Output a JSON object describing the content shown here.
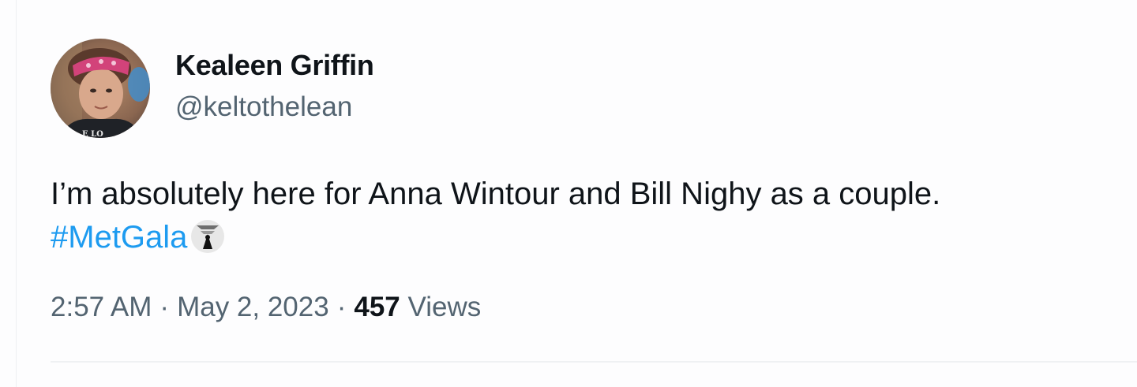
{
  "author": {
    "display_name": "Kealeen Griffin",
    "handle": "@keltothelean",
    "avatar_icon": "profile-photo"
  },
  "tweet": {
    "text_line_1": "I’m absolutely here for Anna Wintour and Bill Nighy as a couple.",
    "hashtag": "#MetGala",
    "hashflag_icon": "met-gala-hashflag-icon"
  },
  "meta": {
    "time": "2:57 AM",
    "separator": "·",
    "date": "May 2, 2023",
    "views_count": "457",
    "views_label": "Views"
  },
  "colors": {
    "text": "#0f1419",
    "secondary": "#536471",
    "link": "#1d9bf0"
  }
}
